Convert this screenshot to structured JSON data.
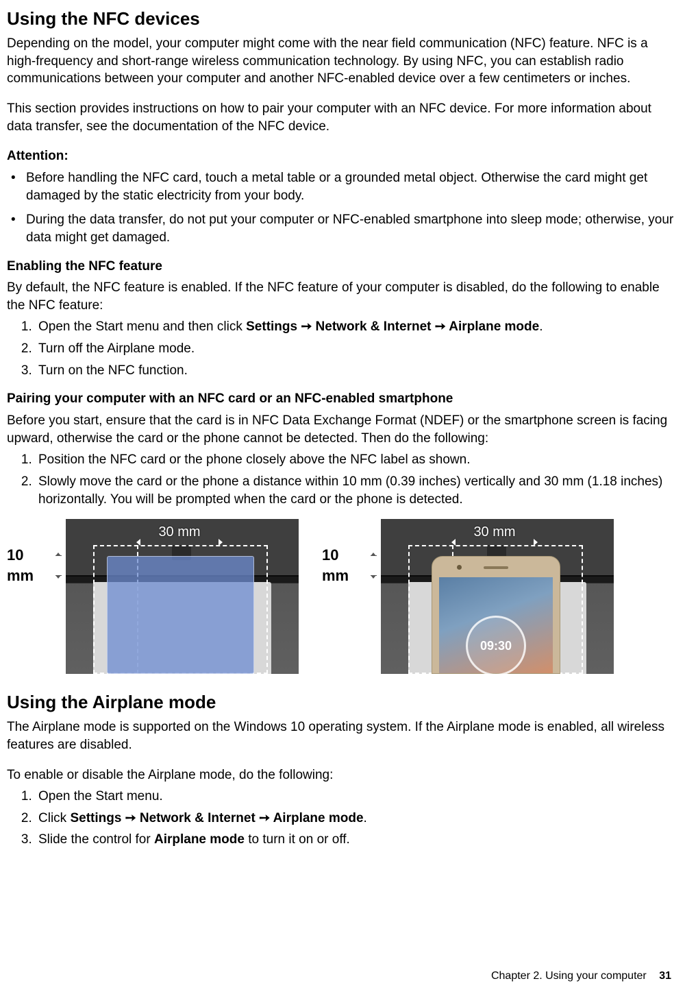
{
  "nfc": {
    "heading": "Using the NFC devices",
    "para1": "Depending on the model, your computer might come with the near field communication (NFC) feature. NFC is a high-frequency and short-range wireless communication technology. By using NFC, you can establish radio communications between your computer and another NFC-enabled device over a few centimeters or inches.",
    "para2": "This section provides instructions on how to pair your computer with an NFC device. For more information about data transfer, see the documentation of the NFC device.",
    "attention_label": "Attention:",
    "attention_items": [
      "Before handling the NFC card, touch a metal table or a grounded metal object. Otherwise the card might get damaged by the static electricity from your body.",
      "During the data transfer, do not put your computer or NFC-enabled smartphone into sleep mode; otherwise, your data might get damaged."
    ],
    "enable_heading": "Enabling the NFC feature",
    "enable_intro": "By default, the NFC feature is enabled. If the NFC feature of your computer is disabled, do the following to enable the NFC feature:",
    "enable_steps": {
      "s1_prefix": "Open the Start menu and then click ",
      "s1_bold": "Settings ➙ Network & Internet ➙ Airplane mode",
      "s1_suffix": ".",
      "s2": "Turn off the Airplane mode.",
      "s3": "Turn on the NFC function."
    },
    "pairing_heading": "Pairing your computer with an NFC card or an NFC-enabled smartphone",
    "pairing_intro": "Before you start, ensure that the card is in NFC Data Exchange Format (NDEF) or the smartphone screen is facing upward, otherwise the card or the phone cannot be detected. Then do the following:",
    "pairing_steps": [
      "Position the NFC card or the phone closely above the NFC label as shown.",
      "Slowly move the card or the phone a distance within 10 mm (0.39 inches) vertically and 30 mm (1.18 inches) horizontally. You will be prompted when the card or the phone is detected."
    ],
    "fig": {
      "v_label": "10 mm",
      "h_label": "30 mm",
      "phone_time": "09:30"
    }
  },
  "airplane": {
    "heading": "Using the Airplane mode",
    "para1": "The Airplane mode is supported on the Windows 10 operating system. If the Airplane mode is enabled, all wireless features are disabled.",
    "para2": "To enable or disable the Airplane mode, do the following:",
    "steps": {
      "s1": "Open the Start menu.",
      "s2_prefix": "Click ",
      "s2_bold": "Settings ➙ Network & Internet ➙ Airplane mode",
      "s2_suffix": ".",
      "s3_prefix": "Slide the control for ",
      "s3_bold": "Airplane mode",
      "s3_suffix": " to turn it on or off."
    }
  },
  "footer": {
    "chapter": "Chapter 2. Using your computer",
    "page": "31"
  }
}
